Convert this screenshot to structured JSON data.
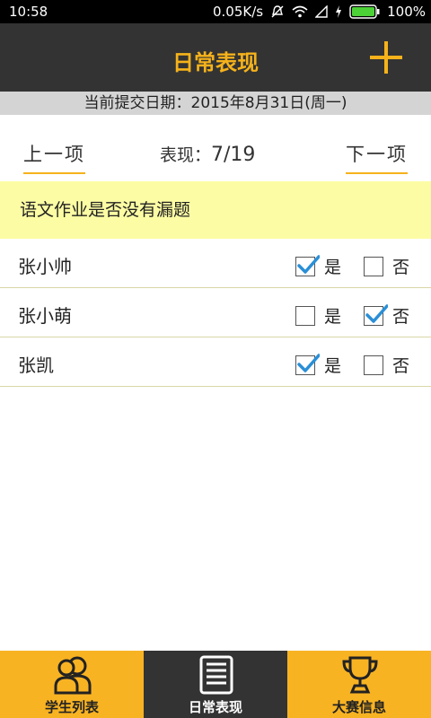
{
  "status_bar": {
    "time": "10:58",
    "net_speed": "0.05K/s",
    "battery": "100%"
  },
  "header": {
    "title": "日常表现",
    "add_icon": "plus-icon",
    "accent_color": "#f5b21b"
  },
  "date_strip": {
    "text": "当前提交日期：2015年8月31日(周一)"
  },
  "pager": {
    "prev_label": "上一项",
    "next_label": "下一项",
    "count_label": "表现：",
    "count_value": "7/19"
  },
  "question": {
    "text": "语文作业是否没有漏题"
  },
  "students": [
    {
      "name": "张小帅",
      "yes_label": "是",
      "no_label": "否",
      "answer": "yes"
    },
    {
      "name": "张小萌",
      "yes_label": "是",
      "no_label": "否",
      "answer": "no"
    },
    {
      "name": "张凯",
      "yes_label": "是",
      "no_label": "否",
      "answer": "yes"
    }
  ],
  "tabs": [
    {
      "label": "学生列表",
      "icon": "users-icon",
      "active": false
    },
    {
      "label": "日常表现",
      "icon": "document-list-icon",
      "active": true
    },
    {
      "label": "大赛信息",
      "icon": "trophy-icon",
      "active": false
    }
  ]
}
